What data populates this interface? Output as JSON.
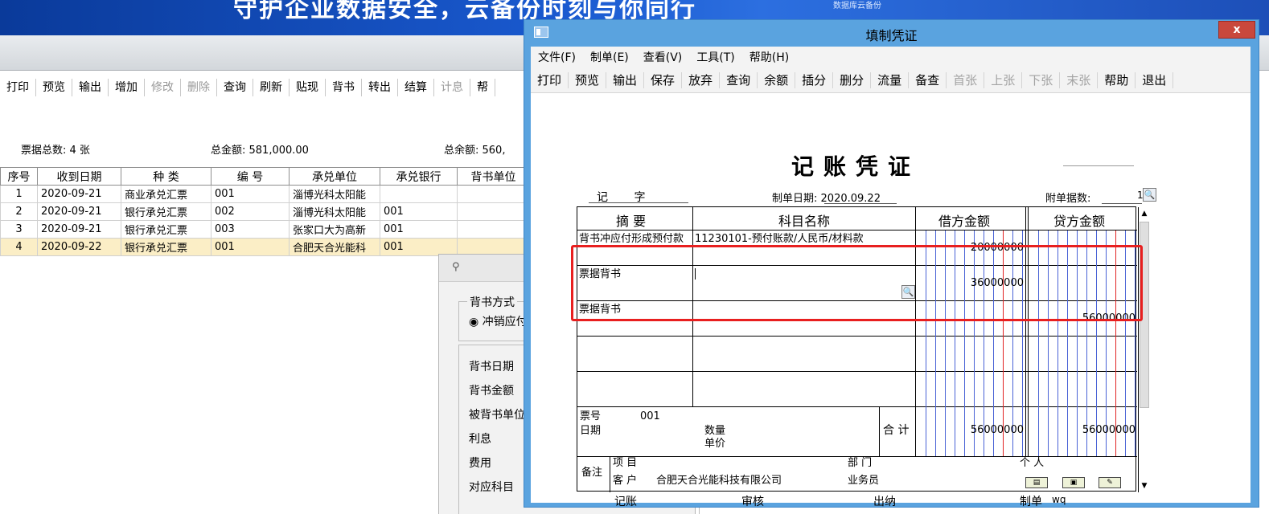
{
  "banner": {
    "title": "守护企业数据安全，云备份时刻与你同行",
    "subtitle": "数据库云备份"
  },
  "bg_toolbar": [
    {
      "label": "打印",
      "disabled": false
    },
    {
      "label": "预览",
      "disabled": false
    },
    {
      "label": "输出",
      "disabled": false
    },
    {
      "label": "增加",
      "disabled": false
    },
    {
      "label": "修改",
      "disabled": true
    },
    {
      "label": "删除",
      "disabled": true
    },
    {
      "label": "查询",
      "disabled": false
    },
    {
      "label": "刷新",
      "disabled": false
    },
    {
      "label": "贴现",
      "disabled": false
    },
    {
      "label": "背书",
      "disabled": false
    },
    {
      "label": "转出",
      "disabled": false
    },
    {
      "label": "结算",
      "disabled": false
    },
    {
      "label": "计息",
      "disabled": true
    },
    {
      "label": "帮",
      "disabled": false
    }
  ],
  "summary": {
    "count_label": "票据总数: 4 张",
    "amount_label": "总金额: 581,000.00",
    "balance_label": "总余额: 560,"
  },
  "grid": {
    "headers": [
      "序号",
      "收到日期",
      "种 类",
      "编 号",
      "承兑单位",
      "承兑银行",
      "背书单位"
    ],
    "rows": [
      [
        "1",
        "2020-09-21",
        "商业承兑汇票",
        "001",
        "淄博光科太阳能",
        "",
        ""
      ],
      [
        "2",
        "2020-09-21",
        "银行承兑汇票",
        "002",
        "淄博光科太阳能",
        "001",
        ""
      ],
      [
        "3",
        "2020-09-21",
        "银行承兑汇票",
        "003",
        "张家口大为高新",
        "001",
        ""
      ],
      [
        "4",
        "2020-09-22",
        "银行承兑汇票",
        "001",
        "合肥天合光能科",
        "001",
        ""
      ]
    ],
    "selected_row": 3
  },
  "endorse_dialog": {
    "group_label": "背书方式",
    "radio_label": "冲销应付",
    "fields": [
      "背书日期",
      "背书金额",
      "被背书单位",
      "利息",
      "费用",
      "对应科目"
    ]
  },
  "voucher_window": {
    "title": "填制凭证",
    "close_label": "x",
    "menu": [
      "文件(F)",
      "制单(E)",
      "查看(V)",
      "工具(T)",
      "帮助(H)"
    ],
    "toolbar": [
      {
        "label": "打印",
        "disabled": false
      },
      {
        "label": "预览",
        "disabled": false
      },
      {
        "label": "输出",
        "disabled": false
      },
      {
        "label": "保存",
        "disabled": false
      },
      {
        "label": "放弃",
        "disabled": false
      },
      {
        "label": "查询",
        "disabled": false
      },
      {
        "label": "余额",
        "disabled": false
      },
      {
        "label": "插分",
        "disabled": false
      },
      {
        "label": "删分",
        "disabled": false
      },
      {
        "label": "流量",
        "disabled": false
      },
      {
        "label": "备查",
        "disabled": false
      },
      {
        "label": "首张",
        "disabled": true
      },
      {
        "label": "上张",
        "disabled": true
      },
      {
        "label": "下张",
        "disabled": true
      },
      {
        "label": "末张",
        "disabled": true
      },
      {
        "label": "帮助",
        "disabled": false
      },
      {
        "label": "退出",
        "disabled": false
      }
    ],
    "voucher": {
      "heading": "记账凭证",
      "type_label": "记 字",
      "date_label": "制单日期:",
      "date_value": "2020.09.22",
      "attach_label": "附单据数:",
      "attach_value": "1",
      "col_summary": "摘 要",
      "col_account": "科目名称",
      "col_debit": "借方金额",
      "col_credit": "贷方金额",
      "entries": [
        {
          "summary": "背书冲应付形成预付款",
          "account": "11230101-预付账款/人民币/材料款",
          "debit": "20000000",
          "credit": ""
        },
        {
          "summary": "票据背书",
          "account": "",
          "debit": "36000000",
          "credit": ""
        },
        {
          "summary": "票据背书",
          "account": "",
          "debit": "",
          "credit": "56000000"
        },
        {
          "summary": "",
          "account": "",
          "debit": "",
          "credit": ""
        },
        {
          "summary": "",
          "account": "",
          "debit": "",
          "credit": ""
        }
      ],
      "bill_no_label": "票号",
      "bill_no_value": "001",
      "date_row_label": "日期",
      "qty_label": "数量",
      "price_label": "单价",
      "total_label": "合 计",
      "total_debit": "56000000",
      "total_credit": "56000000",
      "memo_label": "备注",
      "project_label": "项 目",
      "dept_label": "部 门",
      "person_label": "个 人",
      "customer_label": "客 户",
      "customer_value": "合肥天合光能科技有限公司",
      "salesman_label": "业务员",
      "bookkeeper_label": "记账",
      "auditor_label": "审核",
      "cashier_label": "出纳",
      "maker_label": "制单",
      "maker_value": "wq"
    }
  },
  "colors": {
    "highlight": "#e81f1f",
    "window_frame": "#5aa3df",
    "selected_row": "#fbeec6"
  }
}
